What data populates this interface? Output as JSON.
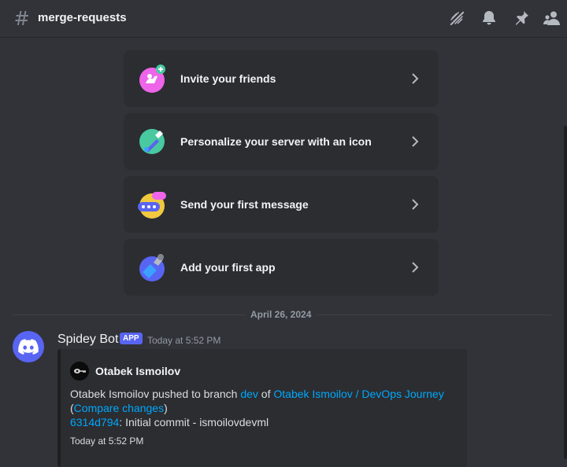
{
  "header": {
    "channel_name": "merge-requests"
  },
  "cards": [
    {
      "label": "Invite your friends",
      "icon": "invite-friends-icon"
    },
    {
      "label": "Personalize your server with an icon",
      "icon": "personalize-icon"
    },
    {
      "label": "Send your first message",
      "icon": "first-message-icon"
    },
    {
      "label": "Add your first app",
      "icon": "first-app-icon"
    }
  ],
  "divider_date": "April 26, 2024",
  "message": {
    "author": "Spidey Bot",
    "badge": "APP",
    "timestamp": "Today at 5:52 PM",
    "embed": {
      "author": "Otabek Ismoilov",
      "text_prefix": "Otabek Ismoilov pushed to branch ",
      "branch": "dev",
      "text_of": " of ",
      "repo": "Otabek Ismoilov / DevOps Journey",
      "paren_open": "(",
      "compare": "Compare changes",
      "paren_close": ")",
      "commit_hash": "6314d794",
      "commit_msg": ": Initial commit - ismoilovdevml",
      "footer": "Today at 5:52 PM"
    }
  },
  "colors": {
    "background": "#313338",
    "card": "#2b2d31",
    "link": "#00a8fc",
    "blurple": "#5865f2"
  }
}
